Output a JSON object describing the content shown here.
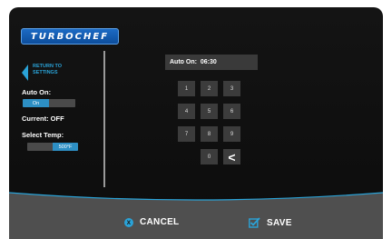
{
  "brand": {
    "logo_text": "TURBOCHEF",
    "accent": "#2aa3d8"
  },
  "left_panel": {
    "back_label": "RETURN TO SETTINGS",
    "auto_on_label": "Auto On:",
    "auto_on_toggle": {
      "selected": "On",
      "options": [
        "On",
        ""
      ]
    },
    "current_status": "Current: OFF",
    "select_temp_label": "Select Temp:",
    "temp_toggle": {
      "selected": "500°F",
      "options": [
        "",
        "500°F"
      ]
    }
  },
  "time_display": {
    "text": "Auto On:  06:30"
  },
  "keypad": {
    "keys": [
      "1",
      "2",
      "3",
      "4",
      "5",
      "6",
      "7",
      "8",
      "9",
      "0"
    ],
    "backspace_glyph": "<"
  },
  "footer": {
    "cancel_label": "CANCEL",
    "cancel_glyph": "x",
    "save_label": "SAVE",
    "background": "#4f4f4f"
  }
}
